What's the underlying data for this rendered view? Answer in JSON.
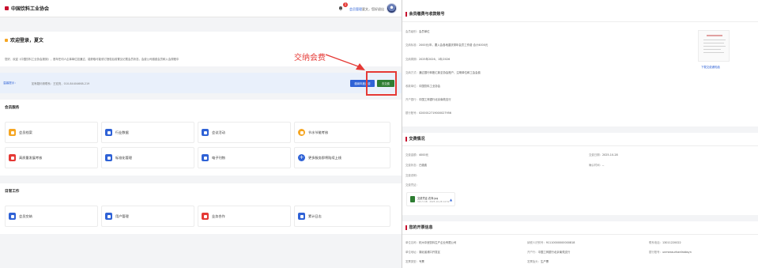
{
  "header": {
    "brand": "中国饮料工业协会",
    "notification_count": "1",
    "link_member": "会员管理",
    "link_user": "夏文，您好退出"
  },
  "welcome": {
    "title": "欢迎登录，夏文",
    "desc": "您好，欢迎《中国饮料工业协会报到》，首年任何人企事单位如通过，能获取可能领订授权后前置见记载会员状态，会费公司缴费会员和入会规程中"
  },
  "annotation": {
    "text": "交纳会费"
  },
  "notice": {
    "label": "温馨提示：",
    "text": "如有疑问请联系：王宏亮，010-84404668-219",
    "btn_primary": "缴纳年度会费",
    "btn_pay": "去交费"
  },
  "services": {
    "title": "会员服务",
    "items": [
      {
        "label": "会员档案",
        "color": "#f5a623"
      },
      {
        "label": "行业数据",
        "color": "#2f62d6"
      },
      {
        "label": "会议活动",
        "color": "#2f62d6"
      },
      {
        "label": "节水节能考核",
        "color": "#f5a623"
      },
      {
        "label": "高质量发展考核",
        "color": "#e53935"
      },
      {
        "label": "标准化管理",
        "color": "#2f62d6"
      },
      {
        "label": "电子刊物",
        "color": "#2f62d6"
      },
      {
        "label": "更多服务即将陆续上线",
        "color": "#2f62d6"
      }
    ]
  },
  "work": {
    "title": "日常工作",
    "items": [
      {
        "label": "会员交纳",
        "color": "#2f62d6"
      },
      {
        "label": "用户管理",
        "color": "#2f62d6"
      },
      {
        "label": "业务合作",
        "color": "#e53935"
      },
      {
        "label": "累计日志",
        "color": "#2f62d6"
      }
    ]
  },
  "fee_standard": {
    "title": "会员缴费与收款账号",
    "rows": [
      {
        "label": "会员级别：",
        "value": "会员单位"
      },
      {
        "label": "交纳标准：",
        "value": "2000元/年，要入会各地重庆带年会员工作费 合计4000元"
      },
      {
        "label": "交纳周期：",
        "value": "2025年2026，1年/2026"
      },
      {
        "label": "交纳方式：",
        "value": "通过银行转账汇款至协会账户，注明单位和工会会费"
      },
      {
        "label": "收款单位：",
        "value": "中国饮料工业协会"
      },
      {
        "label": "开户银行：",
        "value": "中国工商银行北京南苑支行"
      },
      {
        "label": "银行账号：",
        "value": "0200012719000027956"
      }
    ],
    "doc_link": "下载交费通知函"
  },
  "payment_status": {
    "title": "交费情况",
    "amount_label": "交费金额：",
    "amount": "4000元",
    "date_label": "交费日期：",
    "date": "2025-10-28",
    "status_label": "交费状态：",
    "status": "已缴费",
    "receipt_label": "确认时间：",
    "receipt": "--",
    "desc_label": "交费说明：",
    "voucher_label": "交费凭证：",
    "file_name": "交费凭证-农商.jpg",
    "file_meta": "321.5 KB · 2025-10-28 14:52"
  },
  "invoice": {
    "title": "您的开票信息",
    "fields": [
      {
        "label": "单位名称：",
        "value": "杭州中冠饮料生产企业有限公司"
      },
      {
        "label": "纳税人识别号：",
        "value": "91110000000000818"
      },
      {
        "label": "联系电话：",
        "value": "13011220022"
      },
      {
        "label": "单位地址：",
        "value": "湖北省浦口开发区"
      },
      {
        "label": "开户行：",
        "value": "中国工商银行北京南苑支行"
      },
      {
        "label": "银行账号：",
        "value": "unmeasurhanfabbsyn"
      },
      {
        "label": "发票类型：",
        "value": "专票"
      },
      {
        "label": "发票抬头：",
        "value": "生产票"
      }
    ]
  }
}
